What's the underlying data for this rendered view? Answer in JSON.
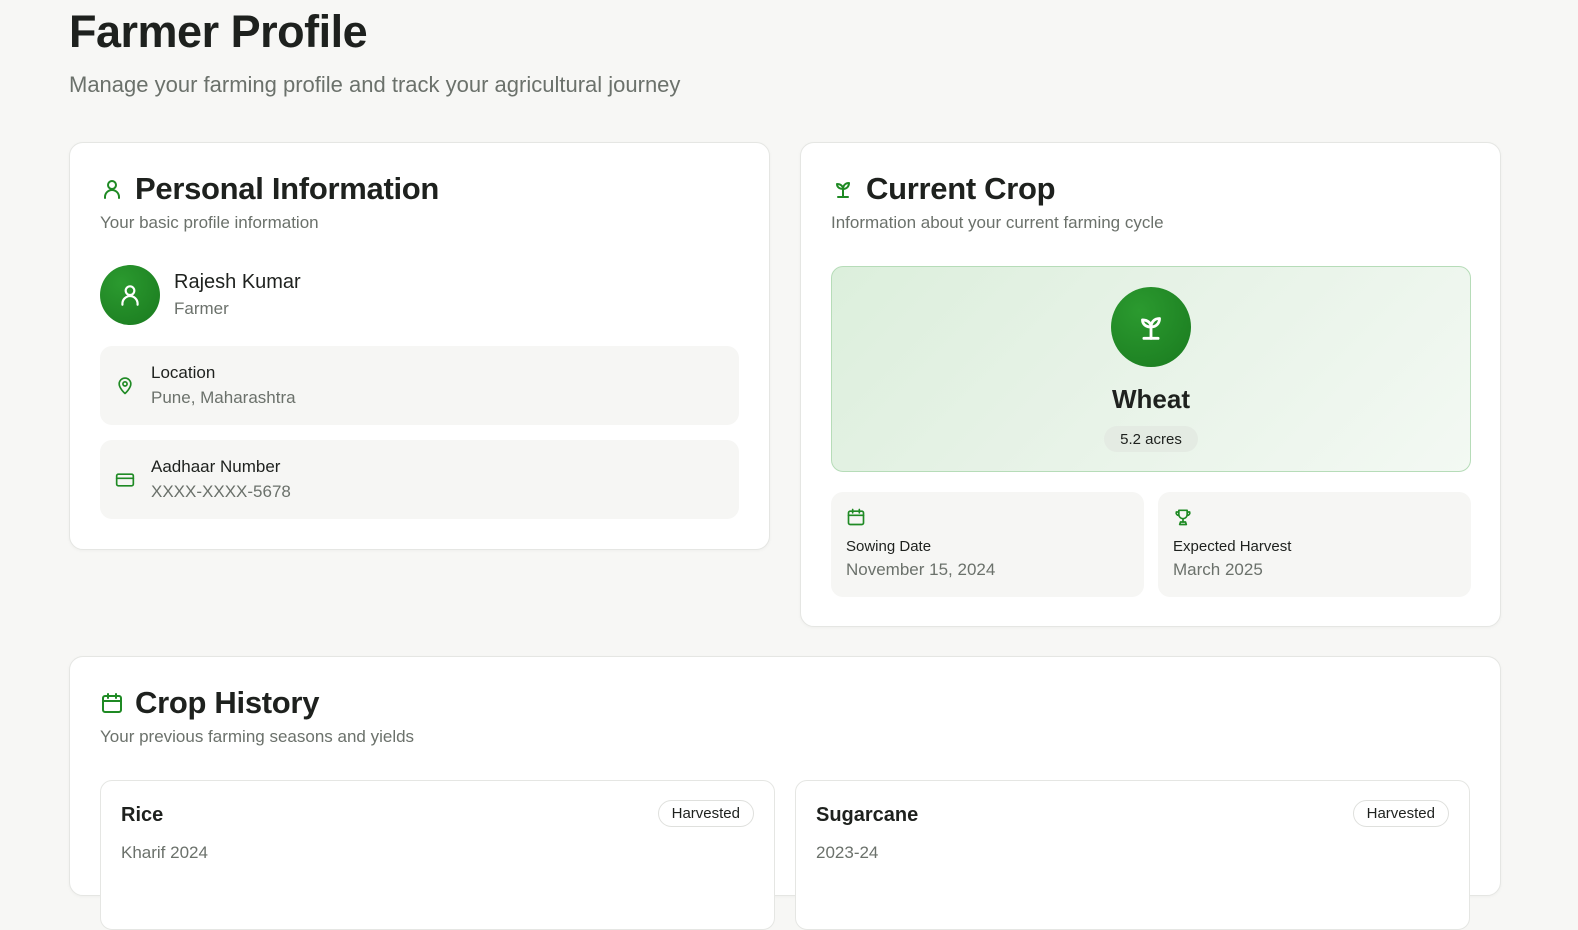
{
  "page": {
    "title": "Farmer Profile",
    "subtitle": "Manage your farming profile and track your agricultural journey"
  },
  "personal": {
    "title": "Personal Information",
    "description": "Your basic profile information",
    "name": "Rajesh Kumar",
    "role": "Farmer",
    "location_label": "Location",
    "location_value": "Pune, Maharashtra",
    "aadhaar_label": "Aadhaar Number",
    "aadhaar_value": "XXXX-XXXX-5678"
  },
  "current_crop": {
    "title": "Current Crop",
    "description": "Information about your current farming cycle",
    "crop_name": "Wheat",
    "area": "5.2 acres",
    "sowing_label": "Sowing Date",
    "sowing_value": "November 15, 2024",
    "harvest_label": "Expected Harvest",
    "harvest_value": "March 2025"
  },
  "history": {
    "title": "Crop History",
    "description": "Your previous farming seasons and yields",
    "items": [
      {
        "crop": "Rice",
        "season": "Kharif 2024",
        "status": "Harvested"
      },
      {
        "crop": "Sugarcane",
        "season": "2023-24",
        "status": "Harvested"
      }
    ]
  },
  "theme": {
    "accent": "#1f8a24",
    "background": "#f7f7f5"
  },
  "icons": {
    "personal": "user-icon",
    "crop": "sprout-icon",
    "location": "map-pin-icon",
    "aadhaar": "credit-card-icon",
    "sowing": "calendar-icon",
    "harvest": "trophy-icon",
    "history": "calendar-icon"
  }
}
